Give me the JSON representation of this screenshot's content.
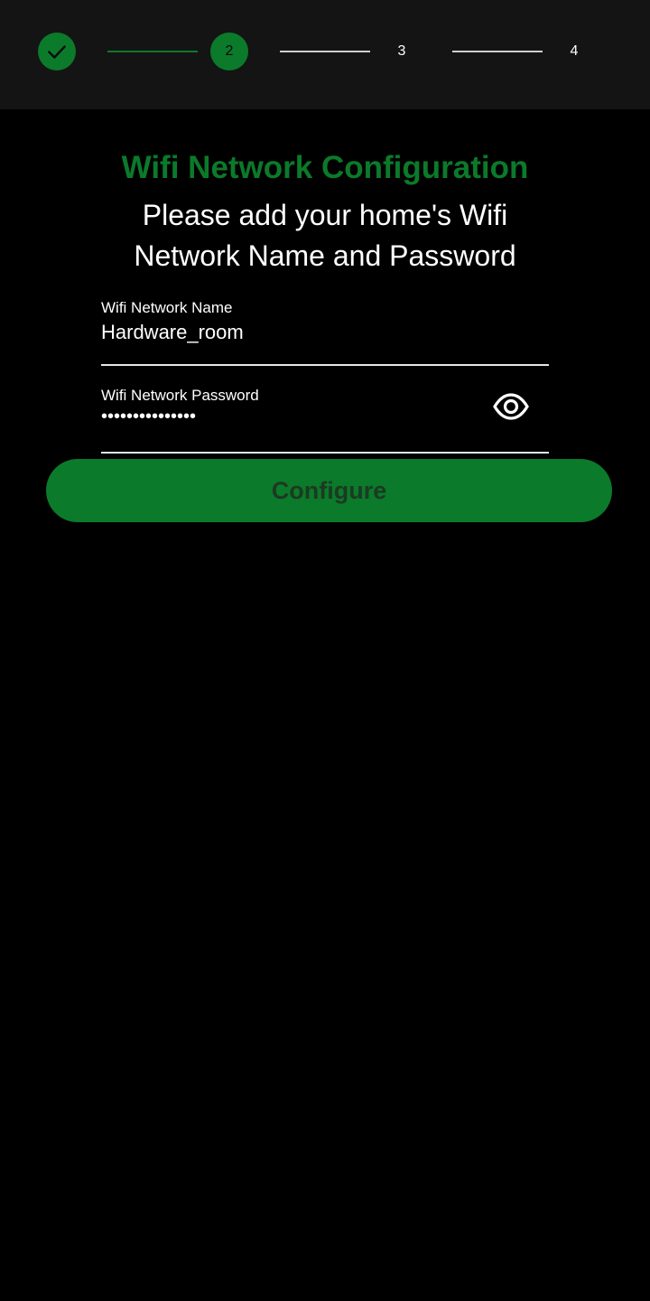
{
  "stepper": {
    "steps": [
      {
        "label": "",
        "state": "done"
      },
      {
        "label": "2",
        "state": "active"
      },
      {
        "label": "3",
        "state": "pending"
      },
      {
        "label": "4",
        "state": "pending"
      }
    ]
  },
  "header": {
    "title": "Wifi Network Configuration",
    "subtitle": "Please add your home's Wifi Network Name and Password"
  },
  "form": {
    "ssid_label": "Wifi Network Name",
    "ssid_value": "Hardware_room",
    "password_label": "Wifi Network Password",
    "password_value": "•••••••••••••••",
    "toggle_icon": "eye-icon"
  },
  "actions": {
    "configure_label": "Configure"
  },
  "colors": {
    "accent": "#0b7a2a",
    "background": "#000000",
    "stepper_bg": "#141414"
  }
}
